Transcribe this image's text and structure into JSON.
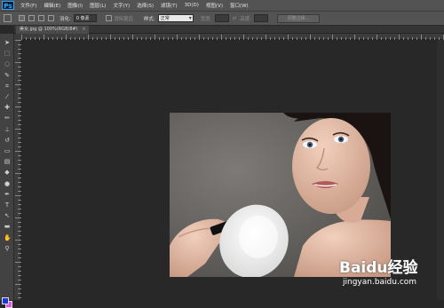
{
  "app": {
    "logo": "Ps"
  },
  "menu": [
    "文件(F)",
    "编辑(E)",
    "图像(I)",
    "图层(L)",
    "文字(Y)",
    "选择(S)",
    "滤镜(T)",
    "3D(D)",
    "视图(V)",
    "窗口(W)"
  ],
  "options": {
    "feather_label": "羽化:",
    "feather_value": "0 像素",
    "antialias_label": "消除锯齿",
    "style_label": "样式:",
    "style_value": "正常",
    "width_label": "宽度:",
    "height_label": "高度:",
    "refine_button": "调整边缘..."
  },
  "document": {
    "tab_title": "美女.jpg @ 100%(RGB/8#)",
    "close_glyph": "×"
  },
  "tools": [
    {
      "name": "move-tool-icon",
      "glyph": "➤"
    },
    {
      "name": "marquee-tool-icon",
      "glyph": "⬚"
    },
    {
      "name": "lasso-tool-icon",
      "glyph": "◌"
    },
    {
      "name": "quick-select-tool-icon",
      "glyph": "✎"
    },
    {
      "name": "crop-tool-icon",
      "glyph": "⌗"
    },
    {
      "name": "eyedropper-tool-icon",
      "glyph": "⁄"
    },
    {
      "name": "healing-brush-tool-icon",
      "glyph": "✚"
    },
    {
      "name": "brush-tool-icon",
      "glyph": "✏"
    },
    {
      "name": "clone-stamp-tool-icon",
      "glyph": "⊥"
    },
    {
      "name": "history-brush-tool-icon",
      "glyph": "↺"
    },
    {
      "name": "eraser-tool-icon",
      "glyph": "▭"
    },
    {
      "name": "gradient-tool-icon",
      "glyph": "▤"
    },
    {
      "name": "blur-tool-icon",
      "glyph": "◆"
    },
    {
      "name": "dodge-tool-icon",
      "glyph": "●"
    },
    {
      "name": "pen-tool-icon",
      "glyph": "✒"
    },
    {
      "name": "type-tool-icon",
      "glyph": "T"
    },
    {
      "name": "path-select-tool-icon",
      "glyph": "↖"
    },
    {
      "name": "shape-tool-icon",
      "glyph": "▬"
    },
    {
      "name": "hand-tool-icon",
      "glyph": "✋"
    },
    {
      "name": "zoom-tool-icon",
      "glyph": "⚲"
    }
  ],
  "colors": {
    "foreground": "#1d36e3",
    "background": "#e058e6"
  },
  "watermark": {
    "logo": "Baidu经验",
    "url": "jingyan.baidu.com"
  }
}
